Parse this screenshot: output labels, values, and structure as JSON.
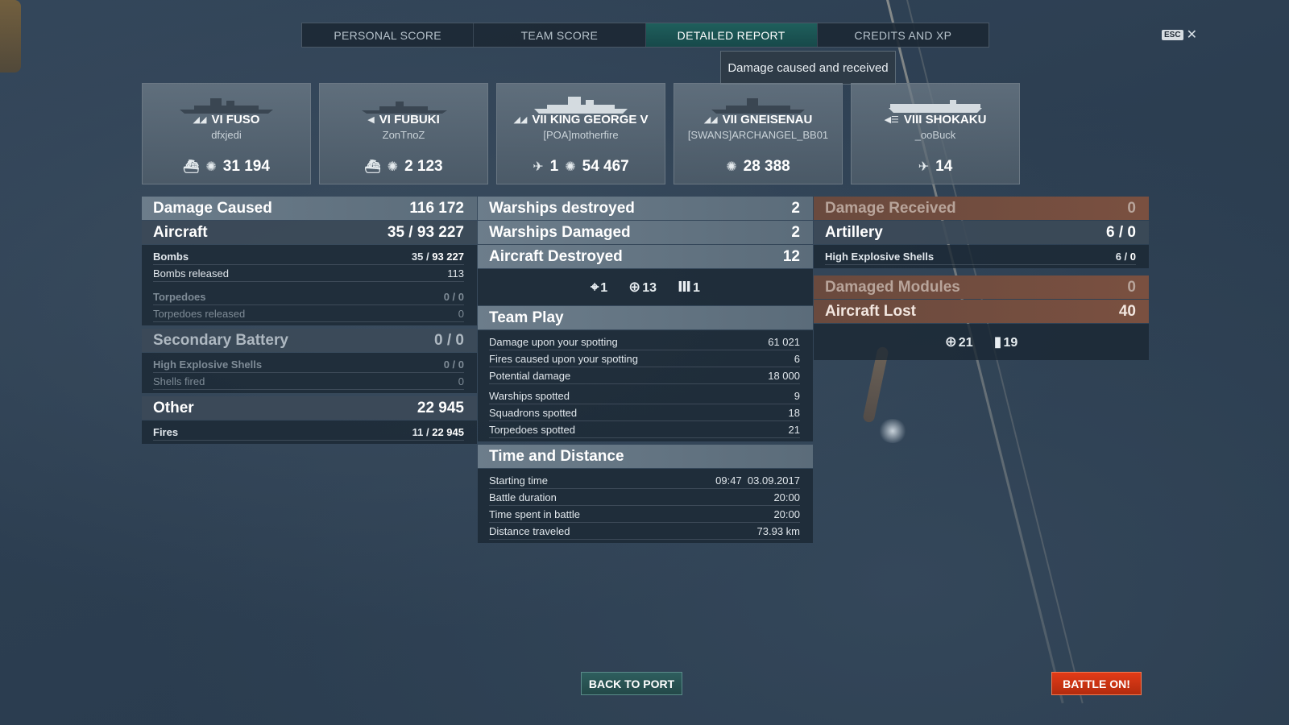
{
  "tabs": [
    {
      "label": "PERSONAL SCORE"
    },
    {
      "label": "TEAM SCORE"
    },
    {
      "label": "DETAILED REPORT"
    },
    {
      "label": "CREDITS AND XP"
    }
  ],
  "esc": {
    "key": "ESC",
    "close": "✕"
  },
  "tooltip": "Damage caused and received",
  "ships": [
    {
      "ship": "VI FUSO",
      "player": "dfxjedi",
      "class_icon": "battleship-icon",
      "stats": [
        {
          "icon": "sunk-icon",
          "value": ""
        },
        {
          "icon": "damage-icon",
          "value": "31 194"
        }
      ]
    },
    {
      "ship": "VI FUBUKI",
      "player": "ZonTnoZ",
      "class_icon": "destroyer-icon",
      "stats": [
        {
          "icon": "sunk-icon",
          "value": ""
        },
        {
          "icon": "damage-icon",
          "value": "2 123"
        }
      ]
    },
    {
      "ship": "VII KING GEORGE V",
      "player": "[POA]motherfire",
      "class_icon": "battleship-icon",
      "stats": [
        {
          "icon": "plane-shot-icon",
          "value": "1"
        },
        {
          "icon": "damage-icon",
          "value": "54 467"
        }
      ]
    },
    {
      "ship": "VII GNEISENAU",
      "player": "[SWANS]ARCHANGEL_BB01",
      "class_icon": "battleship-icon",
      "stats": [
        {
          "icon": "damage-icon",
          "value": "28 388"
        }
      ]
    },
    {
      "ship": "VIII SHOKAKU",
      "player": "_ooBuck",
      "class_icon": "carrier-icon",
      "stats": [
        {
          "icon": "plane-shot-icon",
          "value": "14"
        }
      ]
    }
  ],
  "damage_caused": {
    "label": "Damage Caused",
    "value": "116 172",
    "aircraft": {
      "label": "Aircraft",
      "hits": "35",
      "value": "93 227"
    },
    "bombs": {
      "label": "Bombs",
      "hits": "35",
      "value": "93 227"
    },
    "bombs_released": {
      "label": "Bombs released",
      "value": "113"
    },
    "torpedoes": {
      "label": "Torpedoes",
      "hits": "0",
      "value": "0"
    },
    "torpedoes_released": {
      "label": "Torpedoes released",
      "value": "0"
    },
    "secondary": {
      "label": "Secondary Battery",
      "hits": "0",
      "value": "0"
    },
    "he_shells": {
      "label": "High Explosive Shells",
      "hits": "0",
      "value": "0"
    },
    "shells_fired": {
      "label": "Shells fired",
      "value": "0"
    },
    "other": {
      "label": "Other",
      "value": "22 945"
    },
    "fires": {
      "label": "Fires",
      "hits": "11",
      "value": "22 945"
    }
  },
  "middle": {
    "warships_destroyed": {
      "label": "Warships destroyed",
      "value": "2"
    },
    "warships_damaged": {
      "label": "Warships Damaged",
      "value": "2"
    },
    "aircraft_destroyed": {
      "label": "Aircraft Destroyed",
      "value": "12"
    },
    "aircraft_icons": [
      {
        "icon": "fighter-icon",
        "value": "1"
      },
      {
        "icon": "bomber-icon",
        "value": "13"
      },
      {
        "icon": "aa-icon",
        "value": "1"
      }
    ],
    "team_play": {
      "label": "Team Play",
      "rows": [
        {
          "label": "Damage upon your spotting",
          "value": "61 021"
        },
        {
          "label": "Fires caused upon your spotting",
          "value": "6"
        },
        {
          "label": "Potential damage",
          "value": "18 000"
        },
        {
          "label": "Warships spotted",
          "value": "9"
        },
        {
          "label": "Squadrons spotted",
          "value": "18"
        },
        {
          "label": "Torpedoes spotted",
          "value": "21"
        }
      ]
    },
    "time_distance": {
      "label": "Time and Distance",
      "rows": [
        {
          "label": "Starting time",
          "value": "09:47  03.09.2017"
        },
        {
          "label": "Battle duration",
          "value": "20:00"
        },
        {
          "label": "Time spent in battle",
          "value": "20:00"
        },
        {
          "label": "Distance traveled",
          "value": "73.93 km"
        }
      ]
    }
  },
  "damage_received": {
    "label": "Damage Received",
    "value": "0",
    "artillery": {
      "label": "Artillery",
      "hits": "6",
      "value": "0"
    },
    "he_shells": {
      "label": "High Explosive Shells",
      "hits": "6",
      "value": "0"
    },
    "damaged_modules": {
      "label": "Damaged Modules",
      "value": "0"
    },
    "aircraft_lost": {
      "label": "Aircraft Lost",
      "value": "40"
    },
    "lost_icons": [
      {
        "icon": "bomber-icon",
        "value": "21"
      },
      {
        "icon": "torpedo-bomber-icon",
        "value": "19"
      }
    ]
  },
  "buttons": {
    "back": "BACK TO PORT",
    "battle": "BATTLE ON!"
  }
}
